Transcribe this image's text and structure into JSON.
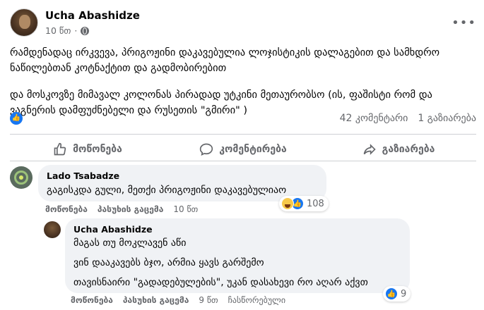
{
  "post": {
    "author": "Ucha Abashidze",
    "time": "10 წთ",
    "paragraphs": [
      "რამდენადაც ირკვევა, პრიგოჟინი დაკავებულია ლოჯისტიკის დალაგებით და სამხდრო ნაწილებთან კოტნაქტით და გადმობირებით",
      "და მოსკოვზე მიმავალ კოლონას პირადად უტკინი მეთაურობსო (ის, ფაშისტი რომ და ვაგნერის დამფუძნებელი და რუსეთის \"გმირი\" )"
    ],
    "comments_count": "42 კომენტარი",
    "shares_count": "1 გაზიარება",
    "actions": {
      "like": "მოწონება",
      "comment": "კომენტირება",
      "share": "გაზიარება"
    }
  },
  "comments": [
    {
      "author": "Lado Tsabadze",
      "text": "გაგისკდა გული, მეთქი პრიგოჟინი დაკავებულიაო",
      "like_label": "მოწონება",
      "reply_label": "პასუხის გაცემა",
      "time": "10 წთ",
      "reaction_count": "108"
    },
    {
      "author": "Ucha Abashidze",
      "lines": [
        "მაგას თუ მოკლავენ აწი",
        "ვინ დააკავებს ბჯო, არმია ყავს გარშემო",
        "თავისნაირი \"გადადებულების\", უკან დასახევი რო აღარ აქვთ"
      ],
      "like_label": "მოწონება",
      "reply_label": "პასუხის გაცემა",
      "time": "9 წთ",
      "edited_label": "ჩასწორებული",
      "reaction_count": "9"
    }
  ],
  "icons": {
    "more": "more-horizontal-icon",
    "privacy": "globe-icon",
    "like": "thumbs-up-icon",
    "comment": "speech-bubble-icon",
    "share": "share-arrow-icon"
  },
  "colors": {
    "accent": "#1877f2",
    "muted_text": "#65676b",
    "bubble_bg": "#f0f2f5"
  }
}
